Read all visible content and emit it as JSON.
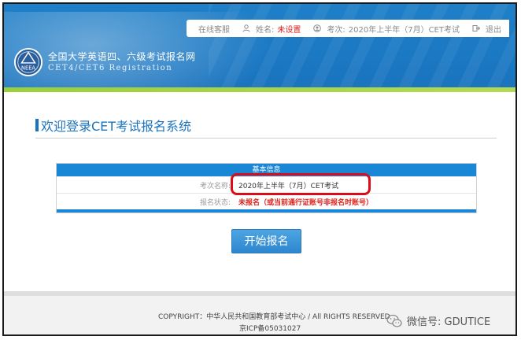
{
  "topbar": {
    "online_service": "在线客服",
    "name_label": "姓名:",
    "name_value": "未设置",
    "exam_label": "考次:",
    "exam_value": "2020年上半年（7月）CET考试",
    "logout": "退出"
  },
  "header": {
    "site_name": "全国大学英语四、六级考试报名网",
    "site_sub": "CET4/CET6  Registration",
    "logo_text": "NEEA"
  },
  "main": {
    "title": "欢迎登录CET考试报名系统",
    "info_title": "基本信息",
    "rows": [
      {
        "label": "考次名称:",
        "value": "2020年上半年（7月）CET考试"
      },
      {
        "label": "报名状态:",
        "value": "未报名（或当前通行证账号非报名时账号）"
      }
    ],
    "start_button": "开始报名"
  },
  "footer": {
    "copyright": "COPYRIGHT：中华人民共和国教育部考试中心 / All RIGHTS RESERVED",
    "icp": "京ICP备05031027",
    "wechat": "微信号: GDUTICE"
  },
  "colors": {
    "header_blue": "#1b78c3",
    "accent_green": "#9ccf3c",
    "highlight_red": "#d90e18",
    "status_red": "#e0221c"
  }
}
